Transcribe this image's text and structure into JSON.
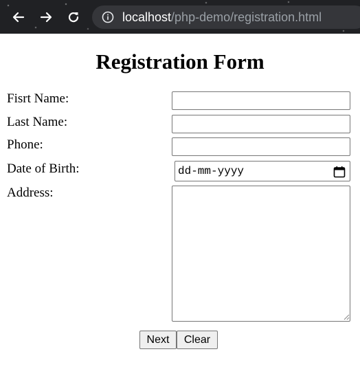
{
  "browser": {
    "url_host": "localhost",
    "url_path": "/php-demo/registration.html",
    "icons": [
      "back-arrow-icon",
      "forward-arrow-icon",
      "reload-icon",
      "site-info-icon"
    ]
  },
  "form": {
    "title": "Registration Form",
    "first_name_label": "Fisrt Name:",
    "first_name_value": "",
    "last_name_label": "Last Name:",
    "last_name_value": "",
    "phone_label": "Phone:",
    "phone_value": "",
    "dob_label": "Date of Birth:",
    "dob_placeholder": "dd-mm-yyyy",
    "address_label": "Address:",
    "address_value": "",
    "next_label": "Next",
    "clear_label": "Clear"
  }
}
